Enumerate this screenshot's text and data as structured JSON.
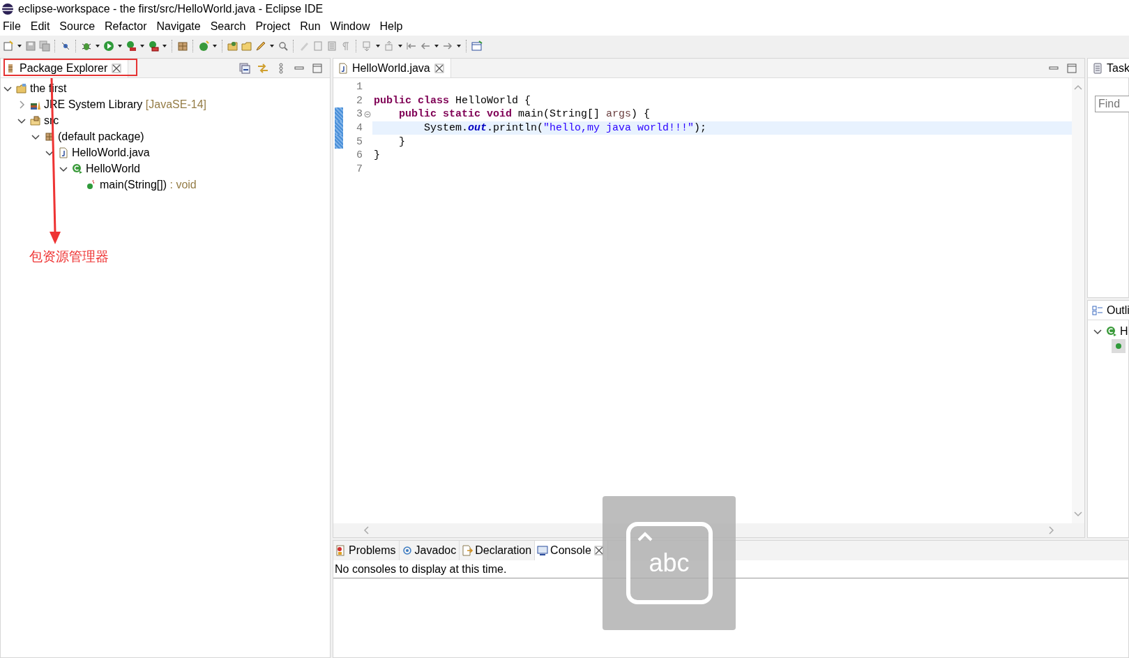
{
  "window": {
    "title": "eclipse-workspace - the first/src/HelloWorld.java - Eclipse IDE"
  },
  "menu": [
    "File",
    "Edit",
    "Source",
    "Refactor",
    "Navigate",
    "Search",
    "Project",
    "Run",
    "Window",
    "Help"
  ],
  "package_explorer": {
    "tab": {
      "label": "Package Explorer",
      "selected": true
    },
    "tree": [
      {
        "label": "the first",
        "kind": "project",
        "expanded": true,
        "children": [
          {
            "label": "JRE System Library",
            "suffix": "[JavaSE-14]",
            "kind": "library",
            "expanded": false
          },
          {
            "label": "src",
            "kind": "source_folder",
            "expanded": true,
            "children": [
              {
                "label": "(default package)",
                "kind": "package",
                "expanded": true,
                "children": [
                  {
                    "label": "HelloWorld.java",
                    "kind": "java_file",
                    "expanded": true,
                    "children": [
                      {
                        "label": "HelloWorld",
                        "kind": "class",
                        "expanded": true,
                        "children": [
                          {
                            "label": "main(String[])",
                            "suffix": ": void",
                            "kind": "method"
                          }
                        ]
                      }
                    ]
                  }
                ]
              }
            ]
          }
        ]
      }
    ]
  },
  "editor": {
    "tab": {
      "label": "HelloWorld.java",
      "selected": true
    },
    "lines": [
      {
        "number": "1",
        "current": false,
        "marked": false,
        "foldable": false
      },
      {
        "number": "2",
        "segments": [
          {
            "text": "public class",
            "kind": "keyword"
          },
          {
            "text": " HelloWorld {",
            "kind": "plain"
          }
        ],
        "current": false,
        "marked": false,
        "foldable": false
      },
      {
        "number": "3",
        "segments": [
          {
            "text": "    public static void",
            "kind": "keyword"
          },
          {
            "text": " main(String[] ",
            "kind": "plain"
          },
          {
            "text": "args",
            "kind": "param"
          },
          {
            "text": ") {",
            "kind": "plain"
          }
        ],
        "current": false,
        "marked": true,
        "foldable": true
      },
      {
        "number": "4",
        "segments": [
          {
            "text": "        System.",
            "kind": "plain"
          },
          {
            "text": "out",
            "kind": "static_field"
          },
          {
            "text": ".println(",
            "kind": "plain"
          },
          {
            "text": "\"hello,my java world!!!\"",
            "kind": "string"
          },
          {
            "text": ");",
            "kind": "plain"
          }
        ],
        "current": true,
        "marked": true,
        "foldable": false
      },
      {
        "number": "5",
        "segments": [
          {
            "text": "    }",
            "kind": "plain"
          }
        ],
        "current": false,
        "marked": true,
        "foldable": false
      },
      {
        "number": "6",
        "segments": [
          {
            "text": "}",
            "kind": "plain"
          }
        ],
        "current": false,
        "marked": false,
        "foldable": false
      },
      {
        "number": "7",
        "current": false,
        "marked": false,
        "foldable": false
      }
    ]
  },
  "task_pane": {
    "tab": {
      "label": "Task"
    },
    "find": {
      "placeholder": "Find"
    }
  },
  "outline_pane": {
    "tab": {
      "label": "Outli"
    },
    "tree": [
      {
        "label": "H",
        "expanded": true,
        "children": [
          {
            "selected": true
          }
        ]
      }
    ]
  },
  "bottom_panel": {
    "tabs": [
      {
        "label": "Problems",
        "kind": "problems",
        "selected": false
      },
      {
        "label": "Javadoc",
        "kind": "javadoc",
        "selected": false
      },
      {
        "label": "Declaration",
        "kind": "declaration",
        "selected": false
      },
      {
        "label": "Console",
        "kind": "console",
        "selected": true
      }
    ],
    "message": "No consoles to display at this time."
  },
  "annotation": {
    "label": "包资源管理器"
  },
  "input_method_overlay": {
    "label": "abc"
  }
}
